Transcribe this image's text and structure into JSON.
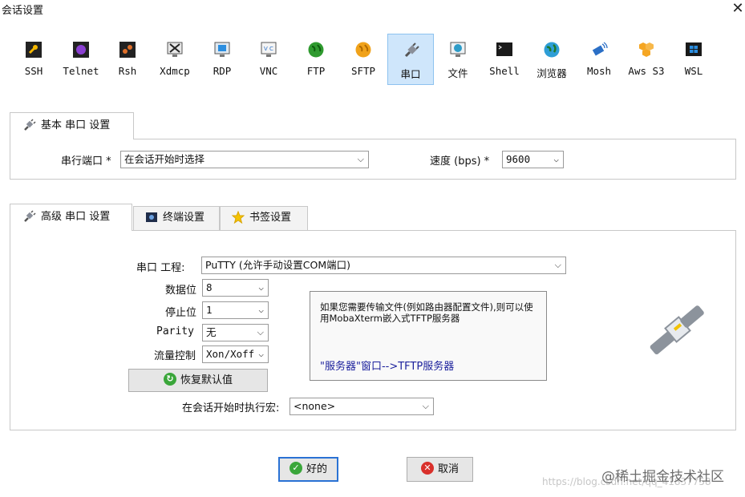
{
  "window": {
    "title": "会话设置",
    "close_glyph": "✕"
  },
  "toolbar": [
    {
      "label": "SSH",
      "icon": "ssh-icon"
    },
    {
      "label": "Telnet",
      "icon": "telnet-icon"
    },
    {
      "label": "Rsh",
      "icon": "rsh-icon"
    },
    {
      "label": "Xdmcp",
      "icon": "xdmcp-icon"
    },
    {
      "label": "RDP",
      "icon": "rdp-icon"
    },
    {
      "label": "VNC",
      "icon": "vnc-icon"
    },
    {
      "label": "FTP",
      "icon": "ftp-icon"
    },
    {
      "label": "SFTP",
      "icon": "sftp-icon"
    },
    {
      "label": "串口",
      "icon": "serial-plug-icon",
      "active": true
    },
    {
      "label": "文件",
      "icon": "file-globe-icon"
    },
    {
      "label": "Shell",
      "icon": "shell-terminal-icon"
    },
    {
      "label": "浏览器",
      "icon": "browser-globe-icon"
    },
    {
      "label": "Mosh",
      "icon": "mosh-satellite-icon"
    },
    {
      "label": "Aws S3",
      "icon": "aws-s3-icon"
    },
    {
      "label": "WSL",
      "icon": "wsl-windows-icon"
    }
  ],
  "basic": {
    "tab_label": "基本 串口 设置",
    "port_label": "串行端口 *",
    "port_value": "在会话开始时选择",
    "speed_label": "速度 (bps) *",
    "speed_value": "9600"
  },
  "advanced": {
    "tabs": [
      "高级 串口 设置",
      "终端设置",
      "书签设置"
    ],
    "engine_label": "串口 工程:",
    "engine_value": "PuTTY  (允许手动设置COM端口)",
    "databits_label": "数据位",
    "databits_value": "8",
    "stopbits_label": "停止位",
    "stopbits_value": "1",
    "parity_label": "Parity",
    "parity_value": "无",
    "flow_label": "流量控制",
    "flow_value": "Xon/Xoff",
    "restore_label": "恢复默认值",
    "macro_label": "在会话开始时执行宏:",
    "macro_value": "<none>",
    "info_text": "如果您需要传输文件(例如路由器配置文件),则可以使用MobaXterm嵌入式TFTP服务器",
    "info_link": "\"服务器\"窗口-->TFTP服务器"
  },
  "buttons": {
    "ok": "好的",
    "cancel": "取消"
  },
  "watermark": {
    "url": "https://blog.csdn.net/qq_41837758",
    "brand": "@稀土掘金技术社区"
  },
  "colors": {
    "accent": "#2a72d4",
    "active_tab_bg": "#cfe6fb",
    "link": "#1a1f9c"
  }
}
